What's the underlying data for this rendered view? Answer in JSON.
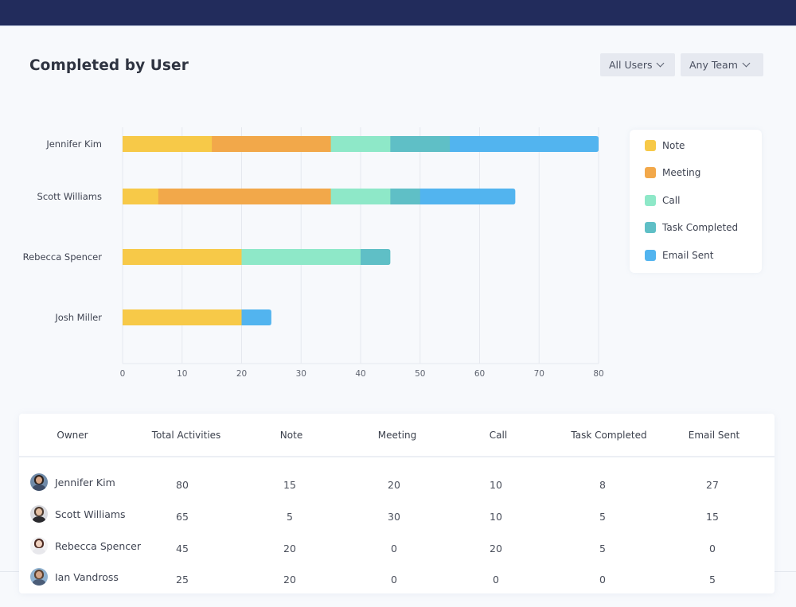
{
  "header": {
    "title": "Completed by User"
  },
  "filters": [
    {
      "label": "All Users",
      "icon": "chevron-down-icon"
    },
    {
      "label": "Any Team",
      "icon": "chevron-down-icon"
    }
  ],
  "colors": {
    "topbar": "#222c5c",
    "note": "#f7c948",
    "meeting": "#f2a84a",
    "call": "#8ee8c8",
    "task_completed": "#5fbfc6",
    "email_sent": "#52b4ef"
  },
  "chart_data": {
    "type": "bar",
    "orientation": "horizontal",
    "stacked": true,
    "title": "Completed by User",
    "xlabel": "",
    "ylabel": "",
    "xlim": [
      0,
      80
    ],
    "x_ticks": [
      "0",
      "10",
      "20",
      "30",
      "40",
      "50",
      "60",
      "70",
      "80"
    ],
    "grid": true,
    "legend_position": "right",
    "categories": [
      "Jennifer Kim",
      "Scott Williams",
      "Rebecca Spencer",
      "Josh Miller"
    ],
    "series": [
      {
        "name": "Note",
        "color": "#f7c948",
        "values": [
          15,
          6,
          20,
          20
        ]
      },
      {
        "name": "Meeting",
        "color": "#f2a84a",
        "values": [
          20,
          29,
          0,
          0
        ]
      },
      {
        "name": "Call",
        "color": "#8ee8c8",
        "values": [
          10,
          10,
          20,
          0
        ]
      },
      {
        "name": "Task Completed",
        "color": "#5fbfc6",
        "values": [
          10,
          5,
          5,
          0
        ]
      },
      {
        "name": "Email Sent",
        "color": "#52b4ef",
        "values": [
          25,
          16,
          0,
          5
        ]
      }
    ]
  },
  "legend": [
    {
      "label": "Note",
      "color": "#f7c948"
    },
    {
      "label": "Meeting",
      "color": "#f2a84a"
    },
    {
      "label": "Call",
      "color": "#8ee8c8"
    },
    {
      "label": "Task Completed",
      "color": "#5fbfc6"
    },
    {
      "label": "Email Sent",
      "color": "#52b4ef"
    }
  ],
  "table": {
    "columns": [
      "Owner",
      "Total Activities",
      "Note",
      "Meeting",
      "Call",
      "Task Completed",
      "Email Sent"
    ],
    "rows": [
      {
        "owner": "Jennifer Kim",
        "total": "80",
        "note": "15",
        "meeting": "20",
        "call": "10",
        "task": "8",
        "email": "27",
        "avatar": {
          "hair": "#2b211d",
          "skin": "#d9a98a",
          "shirt": "#3d4c66",
          "bg": "#6f8aa8"
        }
      },
      {
        "owner": "Scott Williams",
        "total": "65",
        "note": "5",
        "meeting": "30",
        "call": "10",
        "task": "5",
        "email": "15",
        "avatar": {
          "hair": "#4a3a30",
          "skin": "#e3bfa3",
          "shirt": "#2a2a2e",
          "bg": "#d9dadf"
        }
      },
      {
        "owner": "Rebecca Spencer",
        "total": "45",
        "note": "20",
        "meeting": "0",
        "call": "20",
        "task": "5",
        "email": "0",
        "avatar": {
          "hair": "#4b2a22",
          "skin": "#f0d2c0",
          "shirt": "#e8e8ec",
          "bg": "#f2f2f4"
        }
      },
      {
        "owner": "Ian Vandross",
        "total": "25",
        "note": "20",
        "meeting": "0",
        "call": "0",
        "task": "0",
        "email": "5",
        "avatar": {
          "hair": "#5a4030",
          "skin": "#d3a588",
          "shirt": "#4b5d78",
          "bg": "#8fb1cf"
        }
      }
    ]
  }
}
